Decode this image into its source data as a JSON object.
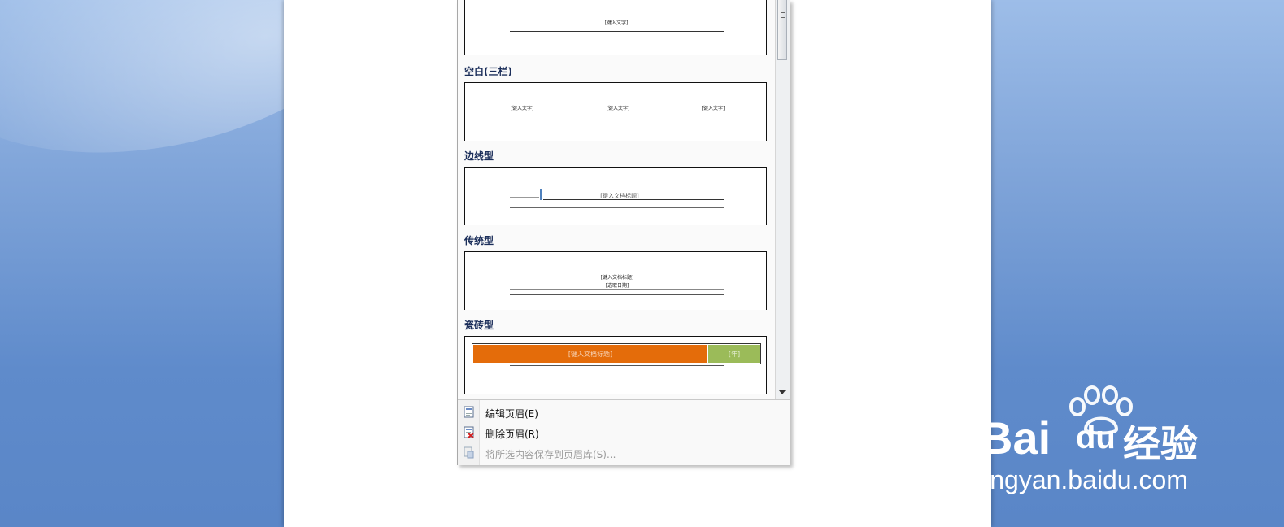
{
  "gallery": {
    "first_preview_text": "[键入文字]",
    "categories": [
      {
        "name": "空白(三栏)",
        "preview": [
          "[键入文字]",
          "[键入文字]",
          "[键入文字]"
        ]
      },
      {
        "name": "边线型",
        "preview": [
          "[键入文档标题]"
        ]
      },
      {
        "name": "传统型",
        "preview": [
          "[键入文档标题]",
          "[选取日期]"
        ]
      },
      {
        "name": "瓷砖型",
        "preview": [
          "[键入文档标题]",
          "[年]"
        ],
        "colors": {
          "primary": "#E46C0A",
          "secondary": "#9BBB59"
        }
      }
    ]
  },
  "menu": {
    "items": [
      {
        "label": "编辑页眉(E)",
        "icon": "edit-header-icon",
        "enabled": true
      },
      {
        "label": "删除页眉(R)",
        "icon": "remove-header-icon",
        "enabled": true
      },
      {
        "label": "将所选内容保存到页眉库(S)...",
        "icon": "save-to-gallery-icon",
        "enabled": false
      }
    ]
  },
  "watermark": {
    "brand": "Bai",
    "brand_suffix": "du",
    "cn": "经验",
    "url": "jingyan.baidu.com"
  }
}
